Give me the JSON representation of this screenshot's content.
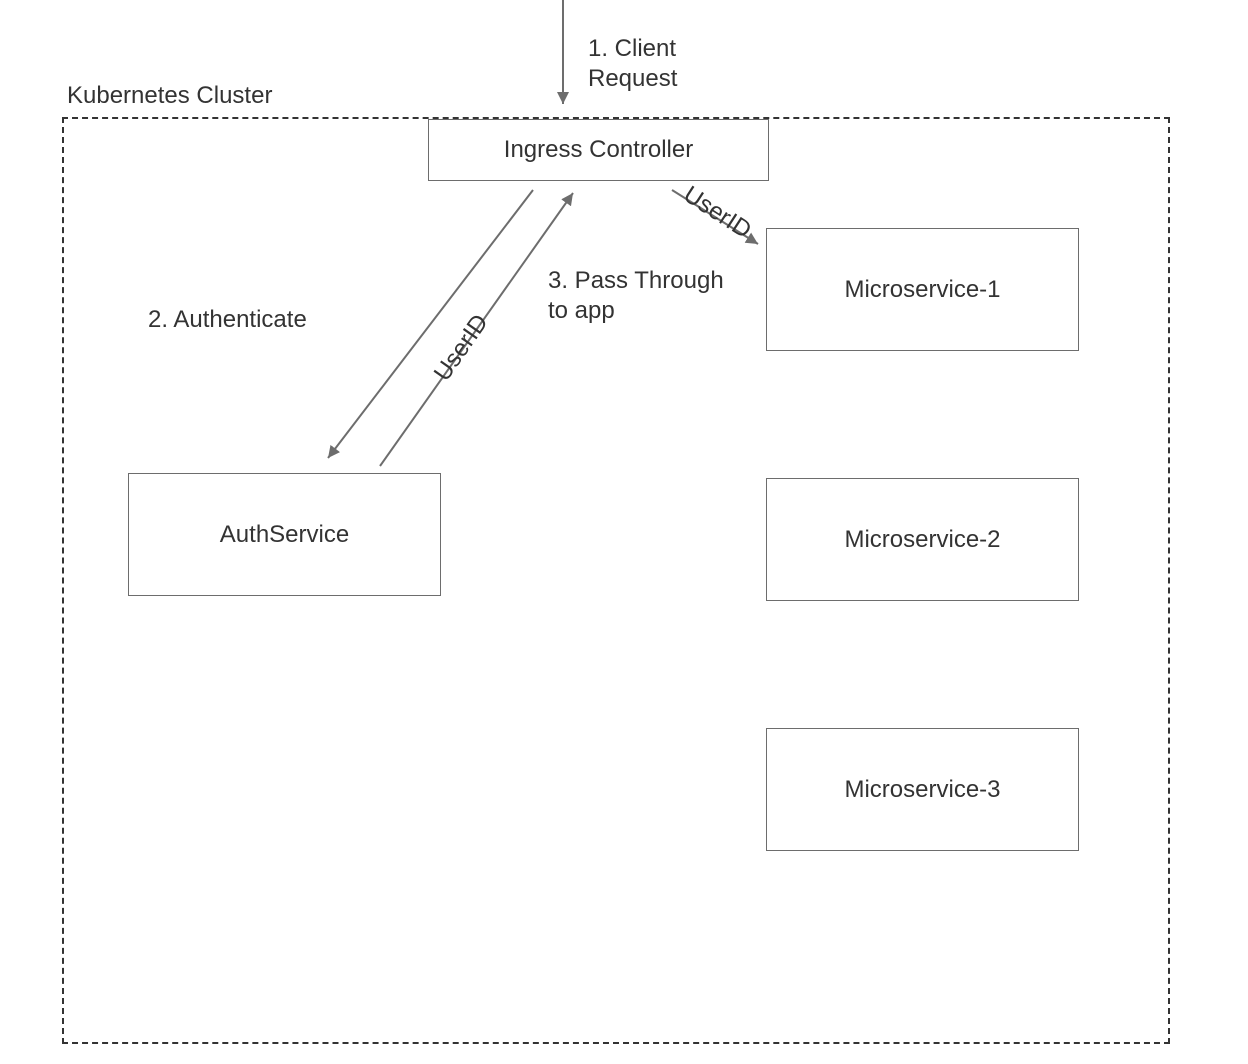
{
  "cluster": {
    "label": "Kubernetes Cluster"
  },
  "nodes": {
    "ingress": {
      "label": "Ingress Controller"
    },
    "auth": {
      "label": "AuthService"
    },
    "ms1": {
      "label": "Microservice-1"
    },
    "ms2": {
      "label": "Microservice-2"
    },
    "ms3": {
      "label": "Microservice-3"
    }
  },
  "edges": {
    "client_request": {
      "label_line1": "1. Client",
      "label_line2": "Request"
    },
    "authenticate": {
      "label": "2. Authenticate"
    },
    "auth_return": {
      "label": "UserID"
    },
    "pass_through": {
      "label_line1": "3. Pass Through",
      "label_line2": "to app",
      "label_edge": "UserID"
    }
  },
  "colors": {
    "stroke": "#6d6d6d",
    "text": "#333333",
    "border_dashed": "#333333"
  }
}
